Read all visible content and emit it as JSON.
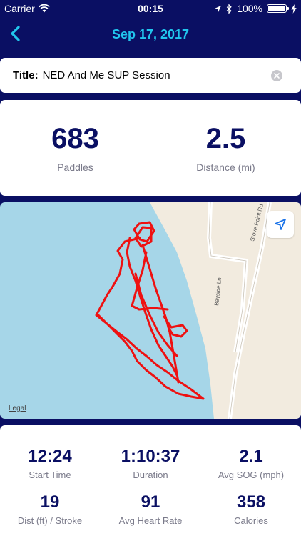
{
  "status_bar": {
    "carrier": "Carrier",
    "time": "00:15",
    "battery_percent": "100%",
    "battery_level": 1.0
  },
  "nav": {
    "title": "Sep 17, 2017"
  },
  "session": {
    "title_label": "Title:",
    "title_value": "NED And Me SUP Session"
  },
  "summary": [
    {
      "value": "683",
      "label": "Paddles"
    },
    {
      "value": "2.5",
      "label": "Distance (mi)"
    }
  ],
  "map": {
    "roads": [
      "Bayside Ln",
      "Stove Point Rd"
    ],
    "legal": "Legal",
    "colors": {
      "water": "#a6d6e8",
      "land": "#f2ebdf",
      "track": "#ee1111"
    }
  },
  "stats": [
    {
      "value": "12:24",
      "label": "Start Time"
    },
    {
      "value": "1:10:37",
      "label": "Duration"
    },
    {
      "value": "2.1",
      "label": "Avg SOG (mph)"
    },
    {
      "value": "19",
      "label": "Dist (ft) / Stroke"
    },
    {
      "value": "91",
      "label": "Avg Heart Rate"
    },
    {
      "value": "358",
      "label": "Calories"
    }
  ],
  "colors": {
    "background": "#0a0f63",
    "accent": "#21c6ee",
    "value_text": "#0a0f63"
  }
}
